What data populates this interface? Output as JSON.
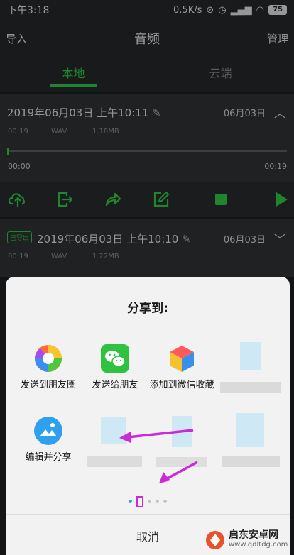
{
  "status_bar": {
    "time": "下午3:18",
    "speed": "0.5K/s",
    "battery": "75"
  },
  "header": {
    "left": "导入",
    "title": "音频",
    "right": "管理"
  },
  "tabs": [
    {
      "label": "本地"
    },
    {
      "label": "云端"
    }
  ],
  "recording1": {
    "title": "2019年06月03日 上午10:11",
    "date": "06月03日",
    "duration": "00:19",
    "format": "WAV",
    "size": "1.18MB",
    "start_time": "00:00",
    "end_time": "00:19",
    "progress": 0
  },
  "recording2": {
    "badge": "已导出",
    "title": "2019年06月03日 上午10:10",
    "date": "06月03日",
    "duration": "00:19",
    "format": "WAV",
    "size": "1.22MB"
  },
  "share_sheet": {
    "title": "分享到:",
    "apps": [
      {
        "label": "发送到朋友圈",
        "icon": "moments-icon"
      },
      {
        "label": "发送给朋友",
        "icon": "wechat-icon"
      },
      {
        "label": "添加到微信收藏",
        "icon": "wechat-favorites-icon"
      },
      {
        "label": "编辑并分享",
        "icon": "gallery-edit-icon"
      }
    ],
    "cancel": "取消",
    "page_count": 5,
    "current_page": 2
  },
  "watermark": {
    "line1": "启东安卓网",
    "line2": "www.qdltdg.com"
  },
  "colors": {
    "accent": "#2fcf48",
    "annotation": "#cc2ad8"
  }
}
